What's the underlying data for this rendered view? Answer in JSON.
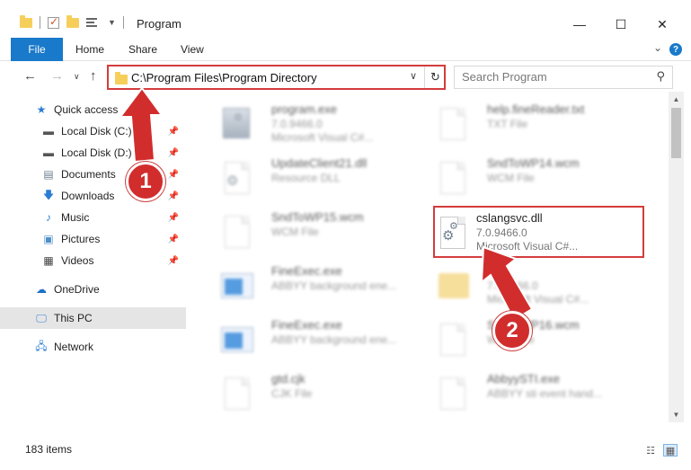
{
  "window": {
    "title": "Program",
    "minimize": "—",
    "maximize": "☐",
    "close": "✕"
  },
  "ribbon": {
    "tabs": [
      "File",
      "Home",
      "Share",
      "View"
    ]
  },
  "address": {
    "path": "C:\\Program Files\\Program Directory"
  },
  "search": {
    "placeholder": "Search Program"
  },
  "sidebar": {
    "items": [
      {
        "label": "Quick access"
      },
      {
        "label": "Local Disk (C:)"
      },
      {
        "label": "Local Disk (D:)"
      },
      {
        "label": "Documents"
      },
      {
        "label": "Downloads"
      },
      {
        "label": "Music"
      },
      {
        "label": "Pictures"
      },
      {
        "label": "Videos"
      },
      {
        "label": "OneDrive"
      },
      {
        "label": "This PC"
      },
      {
        "label": "Network"
      }
    ]
  },
  "files": [
    {
      "name": "program.exe",
      "line1": "7.0.9466.0",
      "line2": "Microsoft Visual C#..."
    },
    {
      "name": "help.fineReader.txt",
      "line1": "TXT File",
      "line2": ""
    },
    {
      "name": "UpdateClient21.dll",
      "line1": "Resource DLL",
      "line2": ""
    },
    {
      "name": "SndToWP14.wcm",
      "line1": "WCM File",
      "line2": ""
    },
    {
      "name": "SndToWP15.wcm",
      "line1": "WCM File",
      "line2": ""
    },
    {
      "name": "cslangsvc.dll",
      "line1": "7.0.9466.0",
      "line2": "Microsoft Visual C#..."
    },
    {
      "name": "FineExec.exe",
      "line1": "ABBYY background ene...",
      "line2": ""
    },
    {
      "name": "el...",
      "line1": "7.0.9466.0",
      "line2": "Microsoft Visual C#..."
    },
    {
      "name": "FineExec.exe",
      "line1": "ABBYY background ene...",
      "line2": ""
    },
    {
      "name": "SndToWP16.wcm",
      "line1": "WCM File",
      "line2": ""
    },
    {
      "name": "gtd.cjk",
      "line1": "CJK File",
      "line2": ""
    },
    {
      "name": "AbbyySTI.exe",
      "line1": "ABBYY sti event hand...",
      "line2": ""
    }
  ],
  "status": {
    "count": "183 items"
  },
  "annotations": {
    "step1": "1",
    "step2": "2",
    "color": "#d12d2d"
  }
}
